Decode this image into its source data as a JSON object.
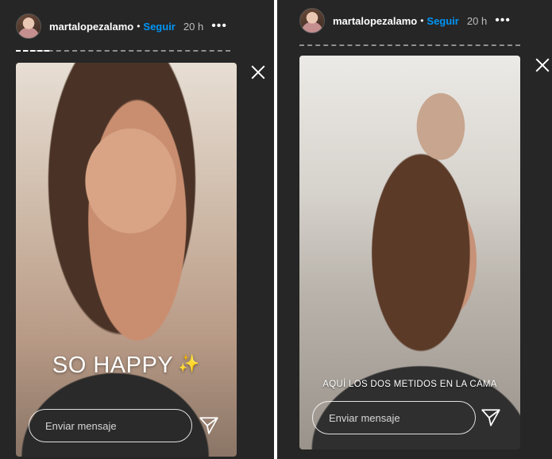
{
  "stories": [
    {
      "username": "martalopezalamo",
      "follow_label": "Seguir",
      "separator": "•",
      "time": "20 h",
      "more": "•••",
      "caption": "SO HAPPY",
      "caption_emoji": "✨",
      "reply_placeholder": "Enviar mensaje",
      "progress": 0.15
    },
    {
      "username": "martalopezalamo",
      "follow_label": "Seguir",
      "separator": "•",
      "time": "20 h",
      "more": "•••",
      "caption": "AQUÍ LOS DOS METIDOS EN LA CAMA",
      "reply_placeholder": "Enviar mensaje",
      "progress": 0.0
    }
  ],
  "colors": {
    "background": "#262626",
    "follow": "#0095f6",
    "text": "#ffffff",
    "muted": "#bdbdbd"
  },
  "icons": [
    "close-icon",
    "send-icon",
    "more-options-icon",
    "sparkles-icon"
  ]
}
